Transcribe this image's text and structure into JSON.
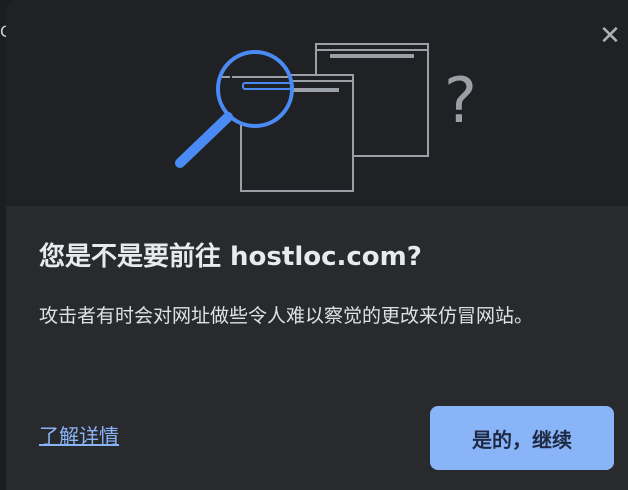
{
  "backdrop": {
    "edge_text": "C"
  },
  "dialog": {
    "close_icon": "close-icon",
    "illustration_icon": "magnifier-over-windows-icon",
    "question_mark": "?",
    "title": "您是不是要前往 hostloc.com?",
    "body": "攻击者有时会对网址做些令人难以察觉的更改来仿冒网站。",
    "learn_more": "了解详情",
    "continue_label": "是的，继续"
  },
  "colors": {
    "dialog_bg": "#292a2d",
    "illustration_bg": "#202124",
    "accent_blue": "#8ab4f8",
    "magnifier_blue": "#4a8af4",
    "window_outline": "#9aa0a6"
  }
}
